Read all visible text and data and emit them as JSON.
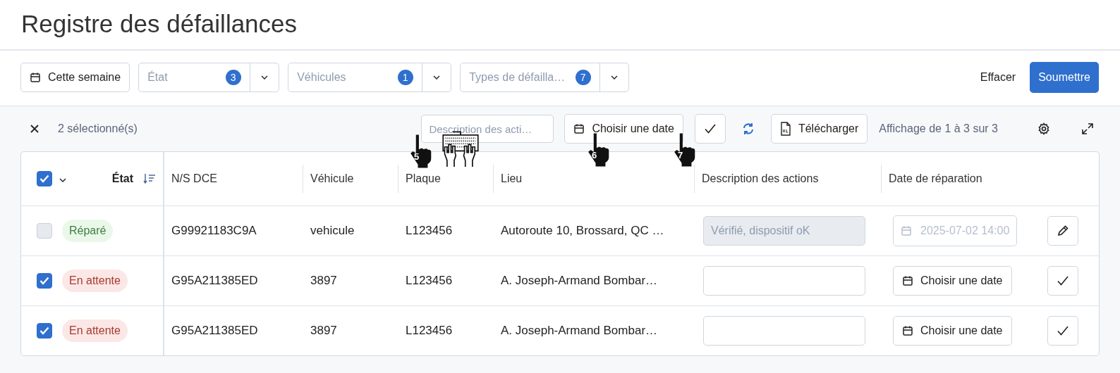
{
  "page": {
    "title": "Registre des défaillances"
  },
  "filters": {
    "period": "Cette semaine",
    "selects": [
      {
        "placeholder": "État",
        "count": "3"
      },
      {
        "placeholder": "Véhicules",
        "count": "1"
      },
      {
        "placeholder": "Types de défailla…",
        "count": "7"
      }
    ],
    "clear": "Effacer",
    "submit": "Soumettre"
  },
  "toolbar": {
    "selected_count": "2 sélectionné(s)",
    "description_placeholder": "Description des acti…",
    "date_button": "Choisir une date",
    "download": "Télécharger",
    "pagination": "Affichage de 1 à 3 sur 3"
  },
  "table": {
    "all_selected": true,
    "state_header": "État",
    "columns": [
      "N/S DCE",
      "Véhicule",
      "Plaque",
      "Lieu",
      "Description des actions",
      "Date de réparation"
    ],
    "rows": [
      {
        "kind": "done",
        "selected": false,
        "status": "Réparé",
        "serial": "G99921183C9A",
        "vehicle": "vehicule",
        "plate": "L123456",
        "location": "Autoroute 10, Brossard, QC …",
        "description": "Vérifié, dispositif oK",
        "date": "2025-07-02 14:00"
      },
      {
        "kind": "pending",
        "selected": true,
        "status": "En attente",
        "serial": "G95A211385ED",
        "vehicle": "3897",
        "plate": "L123456",
        "location": "A. Joseph-Armand Bombar…",
        "date": "Choisir une date"
      },
      {
        "kind": "pending",
        "selected": true,
        "status": "En attente",
        "serial": "G95A211385ED",
        "vehicle": "3897",
        "plate": "L123456",
        "location": "A. Joseph-Armand Bombar…",
        "date": "Choisir une date"
      }
    ]
  },
  "annotations": [
    {
      "kind": "hand",
      "label": "5"
    },
    {
      "kind": "keyboard"
    },
    {
      "kind": "hand",
      "label": "6"
    },
    {
      "kind": "hand",
      "label": "7"
    }
  ]
}
